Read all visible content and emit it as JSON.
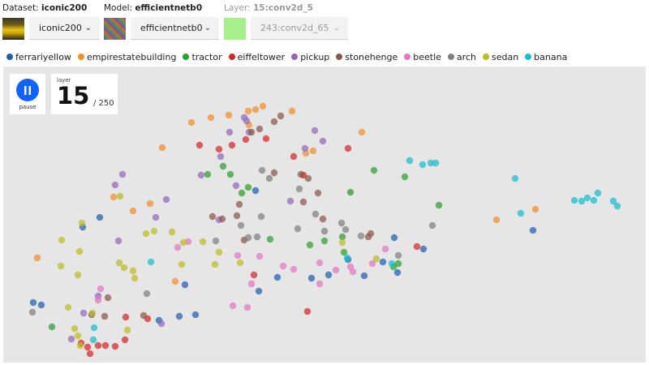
{
  "header": {
    "dataset": {
      "label": "Dataset:",
      "value": "iconic200",
      "select_value": "iconic200"
    },
    "model": {
      "label": "Model:",
      "value": "efficientnetb0",
      "select_value": "efficientnetb0"
    },
    "layer": {
      "label": "Layer:",
      "value": "15:conv2d_5",
      "select_value": "243:conv2d_65"
    }
  },
  "controls": {
    "pause_label": "pause",
    "layer_caption": "layer",
    "layer_value": "15",
    "layer_total": "/ 250"
  },
  "colors": {
    "ferrariyellow": "#1f5fb0",
    "empirestatebuilding": "#f28e2b",
    "tractor": "#2ca02c",
    "eiffeltower": "#d62728",
    "pickup": "#9467bd",
    "stonehenge": "#8c564b",
    "beetle": "#e377c2",
    "arch": "#7f7f7f",
    "sedan": "#bcbd22",
    "banana": "#17becf"
  },
  "chart_data": {
    "type": "scatter",
    "title": "",
    "xlabel": "",
    "ylabel": "",
    "xlim": [
      0,
      792
    ],
    "ylim": [
      0,
      365
    ],
    "grid": false,
    "legend_position": "top",
    "series": [
      {
        "name": "ferrariyellow",
        "color": "#1f5fb0",
        "points": [
          [
            119,
            186
          ],
          [
            98,
            198
          ],
          [
            37,
            291
          ],
          [
            47,
            294
          ],
          [
            192,
            313
          ],
          [
            217,
            308
          ],
          [
            237,
            306
          ],
          [
            315,
            277
          ],
          [
            338,
            260
          ],
          [
            380,
            261
          ],
          [
            401,
            257
          ],
          [
            445,
            258
          ],
          [
            486,
            254
          ],
          [
            482,
            211
          ],
          [
            518,
            225
          ],
          [
            425,
            238
          ],
          [
            468,
            241
          ],
          [
            311,
            153
          ],
          [
            224,
            269
          ],
          [
            653,
            202
          ]
        ]
      },
      {
        "name": "empirestatebuilding",
        "color": "#f28e2b",
        "points": [
          [
            232,
            69
          ],
          [
            256,
            63
          ],
          [
            278,
            60
          ],
          [
            302,
            55
          ],
          [
            311,
            53
          ],
          [
            320,
            49
          ],
          [
            356,
            55
          ],
          [
            442,
            81
          ],
          [
            196,
            100
          ],
          [
            373,
            107
          ],
          [
            382,
            104
          ],
          [
            136,
            161
          ],
          [
            160,
            178
          ],
          [
            181,
            169
          ],
          [
            42,
            236
          ],
          [
            212,
            265
          ],
          [
            608,
            189
          ],
          [
            656,
            176
          ],
          [
            303,
            72
          ]
        ]
      },
      {
        "name": "tractor",
        "color": "#2ca02c",
        "points": [
          [
            271,
            123
          ],
          [
            280,
            133
          ],
          [
            294,
            156
          ],
          [
            302,
            149
          ],
          [
            252,
            133
          ],
          [
            457,
            128
          ],
          [
            495,
            136
          ],
          [
            537,
            171
          ],
          [
            428,
            155
          ],
          [
            329,
            213
          ],
          [
            378,
            220
          ],
          [
            396,
            215
          ],
          [
            418,
            210
          ],
          [
            420,
            229
          ],
          [
            481,
            247
          ],
          [
            487,
            243
          ],
          [
            60,
            321
          ]
        ]
      },
      {
        "name": "eiffeltower",
        "color": "#d62728",
        "points": [
          [
            242,
            97
          ],
          [
            266,
            102
          ],
          [
            282,
            97
          ],
          [
            299,
            90
          ],
          [
            324,
            89
          ],
          [
            358,
            111
          ],
          [
            370,
            134
          ],
          [
            425,
            101
          ],
          [
            151,
            309
          ],
          [
            150,
            337
          ],
          [
            178,
            311
          ],
          [
            96,
            341
          ],
          [
            104,
            346
          ],
          [
            107,
            354
          ],
          [
            117,
            344
          ],
          [
            126,
            344
          ],
          [
            138,
            345
          ],
          [
            510,
            222
          ],
          [
            309,
            257
          ],
          [
            375,
            302
          ]
        ]
      },
      {
        "name": "pickup",
        "color": "#9467bd",
        "points": [
          [
            279,
            81
          ],
          [
            297,
            63
          ],
          [
            303,
            81
          ],
          [
            384,
            79
          ],
          [
            394,
            92
          ],
          [
            372,
            101
          ],
          [
            300,
            67
          ],
          [
            147,
            133
          ],
          [
            138,
            146
          ],
          [
            244,
            134
          ],
          [
            268,
            111
          ],
          [
            287,
            147
          ],
          [
            354,
            166
          ],
          [
            201,
            164
          ],
          [
            188,
            186
          ],
          [
            266,
            189
          ],
          [
            142,
            215
          ],
          [
            117,
            283
          ],
          [
            99,
            304
          ],
          [
            195,
            317
          ],
          [
            84,
            336
          ]
        ]
      },
      {
        "name": "stonehenge",
        "color": "#8c564b",
        "points": [
          [
            306,
            81
          ],
          [
            316,
            77
          ],
          [
            334,
            68
          ],
          [
            342,
            61
          ],
          [
            334,
            131
          ],
          [
            367,
            133
          ],
          [
            376,
            138
          ],
          [
            388,
            156
          ],
          [
            394,
            188
          ],
          [
            258,
            185
          ],
          [
            270,
            188
          ],
          [
            288,
            184
          ],
          [
            129,
            285
          ],
          [
            125,
            308
          ],
          [
            109,
            306
          ],
          [
            173,
            307
          ],
          [
            291,
            170
          ],
          [
            450,
            210
          ],
          [
            453,
            206
          ],
          [
            370,
            167
          ],
          [
            297,
            214
          ]
        ]
      },
      {
        "name": "beetle",
        "color": "#e377c2",
        "points": [
          [
            215,
            223
          ],
          [
            228,
            216
          ],
          [
            120,
            274
          ],
          [
            117,
            288
          ],
          [
            289,
            233
          ],
          [
            316,
            234
          ],
          [
            345,
            246
          ],
          [
            358,
            250
          ],
          [
            390,
            242
          ],
          [
            390,
            268
          ],
          [
            410,
            251
          ],
          [
            428,
            247
          ],
          [
            455,
            243
          ],
          [
            431,
            253
          ],
          [
            471,
            225
          ],
          [
            283,
            295
          ],
          [
            301,
            297
          ],
          [
            306,
            268
          ]
        ]
      },
      {
        "name": "arch",
        "color": "#7f7f7f",
        "points": [
          [
            319,
            128
          ],
          [
            365,
            151
          ],
          [
            385,
            182
          ],
          [
            328,
            138
          ],
          [
            293,
            196
          ],
          [
            302,
            211
          ],
          [
            262,
            215
          ],
          [
            318,
            185
          ],
          [
            441,
            209
          ],
          [
            417,
            193
          ],
          [
            422,
            201
          ],
          [
            396,
            203
          ],
          [
            529,
            196
          ],
          [
            313,
            210
          ],
          [
            363,
            200
          ],
          [
            36,
            303
          ],
          [
            487,
            233
          ],
          [
            177,
            280
          ]
        ]
      },
      {
        "name": "sedan",
        "color": "#bcbd22",
        "points": [
          [
            144,
            160
          ],
          [
            176,
            206
          ],
          [
            186,
            203
          ],
          [
            208,
            204
          ],
          [
            222,
            217
          ],
          [
            220,
            244
          ],
          [
            246,
            216
          ],
          [
            261,
            244
          ],
          [
            266,
            229
          ],
          [
            292,
            242
          ],
          [
            418,
            217
          ],
          [
            460,
            237
          ],
          [
            71,
            246
          ],
          [
            92,
            257
          ],
          [
            94,
            228
          ],
          [
            143,
            242
          ],
          [
            149,
            248
          ],
          [
            162,
            261
          ],
          [
            160,
            252
          ],
          [
            110,
            304
          ],
          [
            153,
            325
          ],
          [
            80,
            297
          ],
          [
            88,
            323
          ],
          [
            92,
            332
          ],
          [
            95,
            344
          ],
          [
            72,
            214
          ],
          [
            97,
            193
          ]
        ]
      },
      {
        "name": "banana",
        "color": "#17becf",
        "points": [
          [
            501,
            116
          ],
          [
            517,
            121
          ],
          [
            527,
            119
          ],
          [
            533,
            119
          ],
          [
            631,
            138
          ],
          [
            704,
            165
          ],
          [
            713,
            166
          ],
          [
            720,
            162
          ],
          [
            728,
            165
          ],
          [
            733,
            156
          ],
          [
            752,
            166
          ],
          [
            757,
            172
          ],
          [
            638,
            181
          ],
          [
            182,
            241
          ],
          [
            111,
            337
          ],
          [
            112,
            322
          ],
          [
            424,
            236
          ],
          [
            479,
            243
          ]
        ]
      }
    ]
  }
}
